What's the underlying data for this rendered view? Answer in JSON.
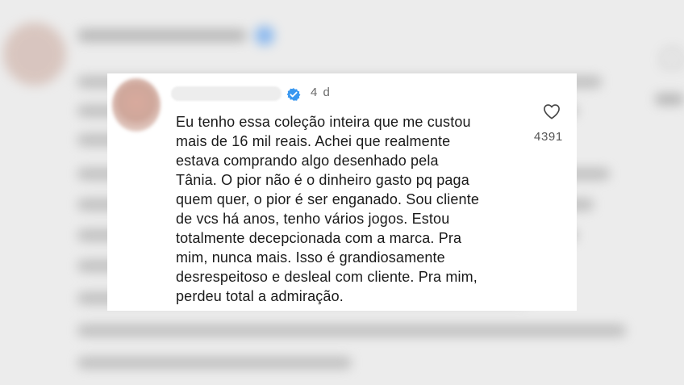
{
  "comment": {
    "timestamp": "4 d",
    "text": "Eu tenho essa coleção inteira que me custou\nmais de 16 mil reais. Achei que realmente\nestava comprando algo desenhado pela\nTânia. O pior não é o dinheiro gasto pq paga\nquem quer, o pior é ser enganado. Sou cliente\nde vcs há anos, tenho vários jogos. Estou\ntotalmente decepcionada com a marca. Pra\nmim, nunca mais. Isso é grandiosamente\ndesrespeitoso e desleal com cliente. Pra mim,\nperdeu total a admiração.",
    "like_count": "4391",
    "icons": {
      "verified": "verified-badge-icon",
      "like": "heart-outline-icon"
    },
    "colors": {
      "verified_badge": "#3897f0",
      "text": "#1a1a1a",
      "meta_text": "#6b6b6b"
    }
  }
}
